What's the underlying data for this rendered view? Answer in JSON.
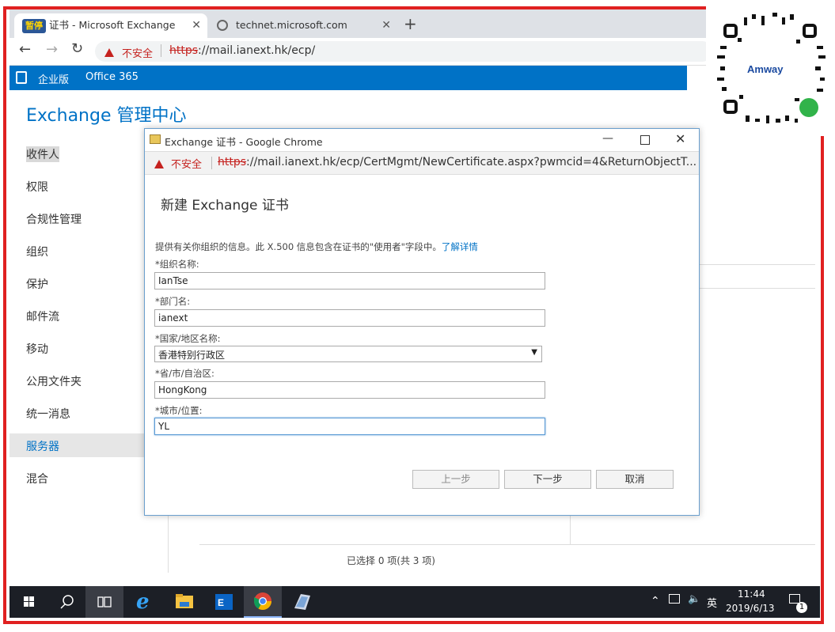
{
  "browser": {
    "tabs": [
      {
        "badge": "暂停",
        "title": "证书 - Microsoft Exchange"
      },
      {
        "title": "technet.microsoft.com"
      }
    ],
    "new_tab": "+",
    "security_label": "不安全",
    "url_scheme": "https",
    "url_rest": "://mail.ianext.hk/ecp/"
  },
  "ecp": {
    "edition": "企业版",
    "office365": "Office 365",
    "title": "Exchange 管理中心",
    "nav": [
      "收件人",
      "权限",
      "合规性管理",
      "组织",
      "保护",
      "邮件流",
      "移动",
      "公用文件夹",
      "统一消息",
      "服务器",
      "混合"
    ],
    "selected_nav": "服务器",
    "status": "已选择 0 项(共 3 项)"
  },
  "popup": {
    "window_title": "Exchange 证书 - Google Chrome",
    "security_label": "不安全",
    "url_scheme": "https",
    "url_rest": "://mail.ianext.hk/ecp/CertMgmt/NewCertificate.aspx?pwmcid=4&ReturnObjectT...",
    "heading": "新建 Exchange 证书",
    "intro": "提供有关你组织的信息。此 X.500 信息包含在证书的\"使用者\"字段中。",
    "learn_more": "了解详情",
    "fields": [
      {
        "label": "*组织名称:",
        "value": "IanTse"
      },
      {
        "label": "*部门名:",
        "value": "ianext"
      },
      {
        "label": "*国家/地区名称:",
        "value": "香港特别行政区"
      },
      {
        "label": "*省/市/自治区:",
        "value": "HongKong"
      },
      {
        "label": "*城市/位置:",
        "value": "YL"
      }
    ],
    "buttons": {
      "back": "上一步",
      "next": "下一步",
      "cancel": "取消"
    }
  },
  "overlay": {
    "brand": "Amway"
  },
  "taskbar": {
    "ime": "英",
    "time": "11:44",
    "date": "2019/6/13",
    "notification_count": "1"
  },
  "colors": {
    "accent": "#0072c6",
    "frame": "#e02020",
    "warning": "#c5221f"
  }
}
